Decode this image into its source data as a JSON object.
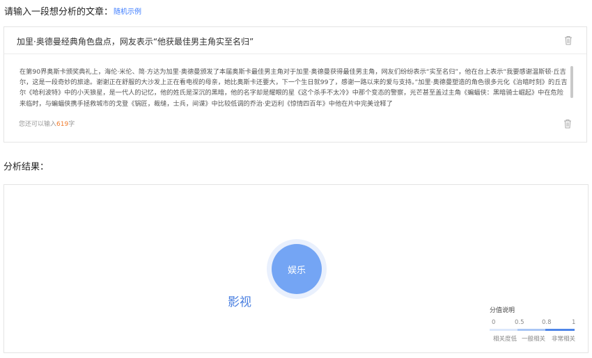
{
  "prompt": {
    "label": "请输入一段想分析的文章：",
    "sample_link": "随机示例"
  },
  "input": {
    "title": "加里·奥德曼经典角色盘点，网友表示“他获最佳男主角实至名归”",
    "body": "在第90界奥斯卡颁奖典礼上，海伦·米伦、简·方达为加里·奥德曼颁发了本届奥斯卡最佳男主角对于加里·奥德曼获得最佳男主角，网友们纷纷表示“实至名归”，他在台上表示“我要感谢温斯顿·丘吉尔，这是一段奇妙的旅途。谢谢正在舒服的大沙发上正在看电视的母亲，她比奥斯卡还要大，下一个生日就99了，感谢一路以来的爱与支持。”加里·奥德曼塑造的角色很多元化《治暗时刻》的丘吉尔《哈利波特》中的小天狼星，是一代人的记忆，他的姓氏是深沉的黑暗，他的名字却是耀眼的星《这个杀手不太冷》中那个变态的警察，光芒甚至盖过主角《蝙蝠侠：黑暗骑士崛起》中在危险来临时，与蝙蝠侠携手拯救城市的戈登《锅匠，裁缝，士兵，间谍》中比较低调的乔治·史迈利《惊情四百年》中他在片中完美诠释了",
    "counter_prefix": "您还可以输入",
    "counter_value": "619",
    "counter_suffix": "字"
  },
  "result": {
    "label": "分析结果：",
    "bubble_label": "娱乐",
    "category_label": "影视"
  },
  "legend": {
    "title": "分值说明",
    "ticks": [
      "0",
      "0.5",
      "0.8",
      "1"
    ],
    "labels": [
      "相关度低",
      "一般相关",
      "非常相关"
    ],
    "colors": [
      "#dbe7fb",
      "#a9c6f5",
      "#4f86e8"
    ]
  },
  "icons": {
    "title_delete": "trash-icon",
    "body_delete": "trash-icon"
  },
  "colors": {
    "accent": "#3c7cff",
    "bubble": "#74a5f4",
    "bubble_halo": "#e9f0fd",
    "counter_highlight": "#f07a2a"
  }
}
